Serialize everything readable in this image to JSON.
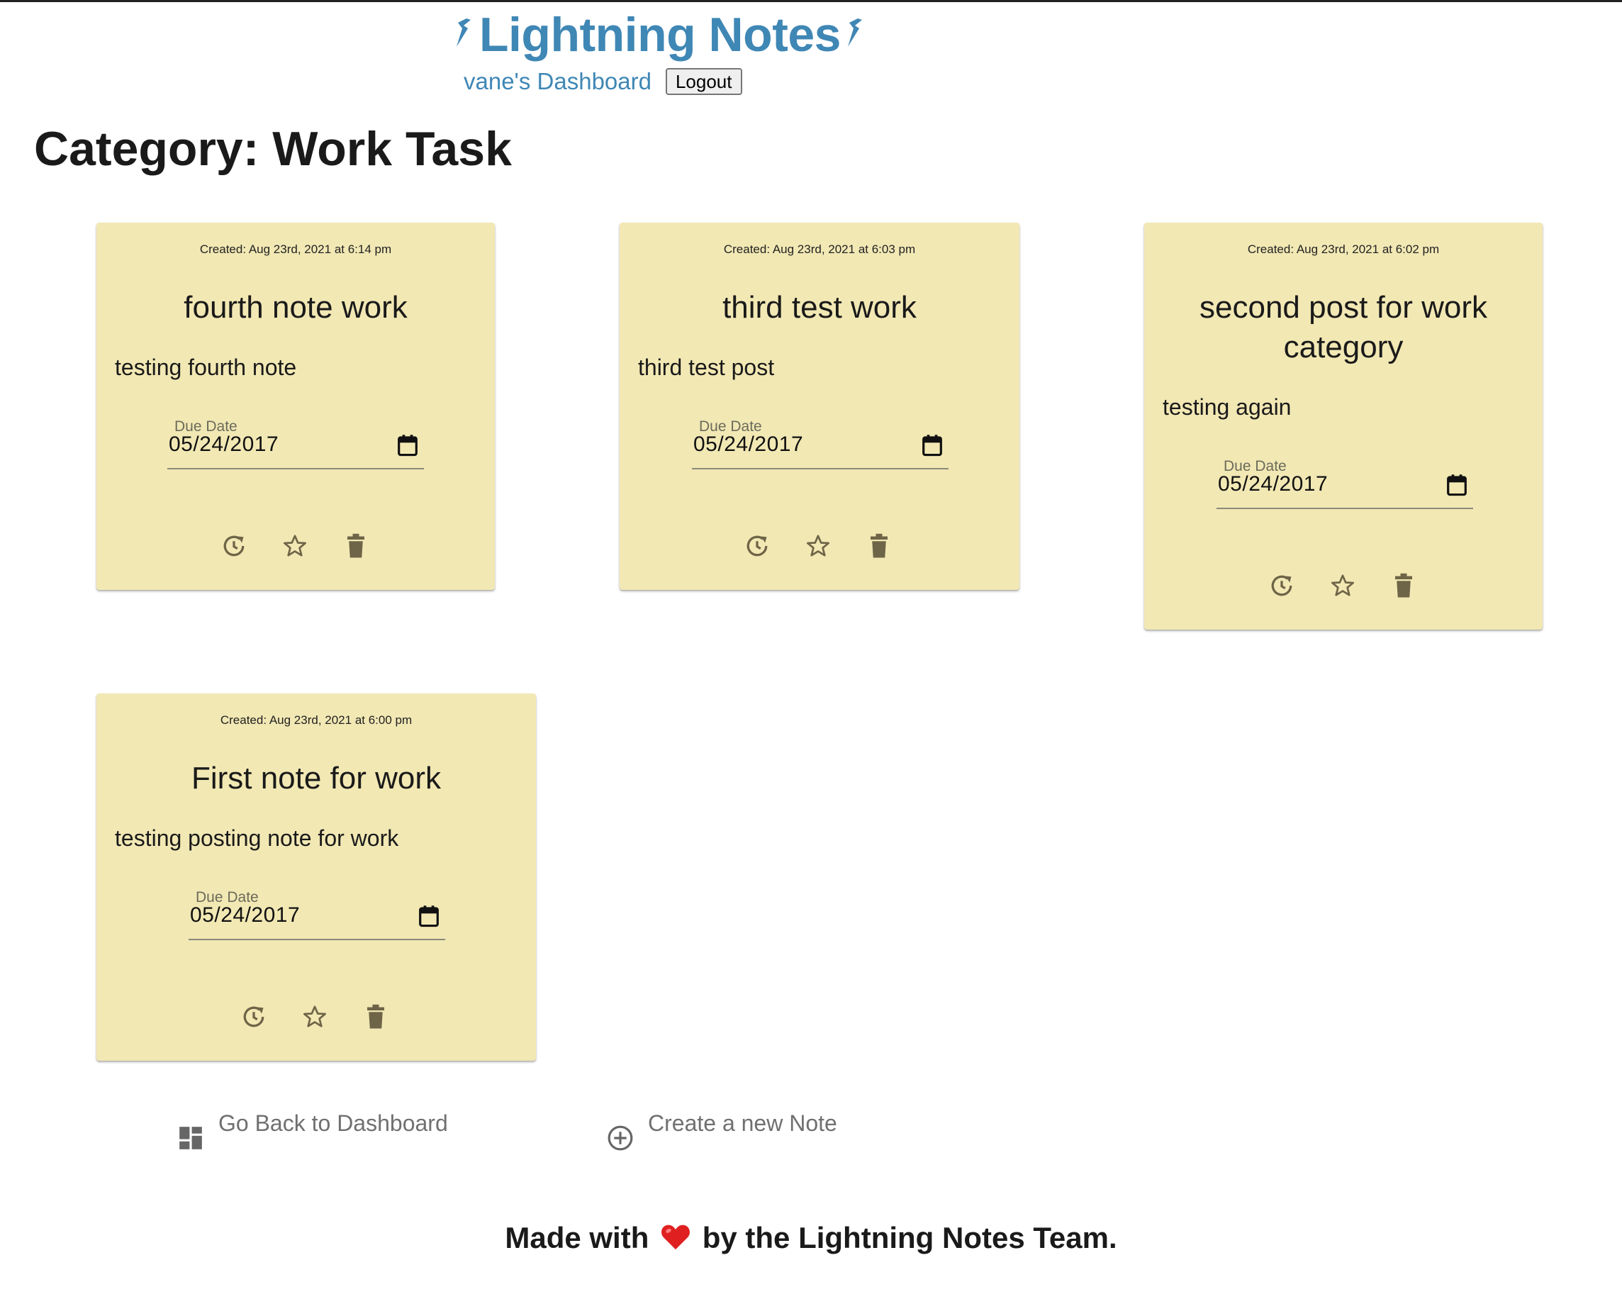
{
  "header": {
    "brand_title": "Lightning Notes",
    "dashboard_link": "vane's Dashboard",
    "logout_label": "Logout",
    "brand_color": "#3f87b5"
  },
  "page": {
    "title": "Category: Work Task"
  },
  "notes": [
    {
      "created": "Created: Aug 23rd, 2021 at 6:14 pm",
      "title": "fourth note work",
      "body": "testing fourth note",
      "due_label": "Due Date",
      "due_value": "05/24/2017"
    },
    {
      "created": "Created: Aug 23rd, 2021 at 6:03 pm",
      "title": "third test work",
      "body": "third test post",
      "due_label": "Due Date",
      "due_value": "05/24/2017"
    },
    {
      "created": "Created: Aug 23rd, 2021 at 6:02 pm",
      "title": "second post for work category",
      "body": "testing again",
      "due_label": "Due Date",
      "due_value": "05/24/2017"
    },
    {
      "created": "Created: Aug 23rd, 2021 at 6:00 pm",
      "title": "First note for work",
      "body": "testing posting note for work",
      "due_label": "Due Date",
      "due_value": "05/24/2017"
    }
  ],
  "note_icons": [
    "history-icon",
    "star-outline-icon",
    "trash-icon"
  ],
  "note_color": "#f2e8b4",
  "bottom_links": {
    "back_label": "Go Back to Dashboard",
    "back_icon": "dashboard-icon",
    "create_label": "Create a new Note",
    "create_icon": "add-circle-icon"
  },
  "footer": {
    "prefix": "Made with",
    "suffix": "by the Lightning Notes Team.",
    "heart_icon": "heart-icon"
  }
}
